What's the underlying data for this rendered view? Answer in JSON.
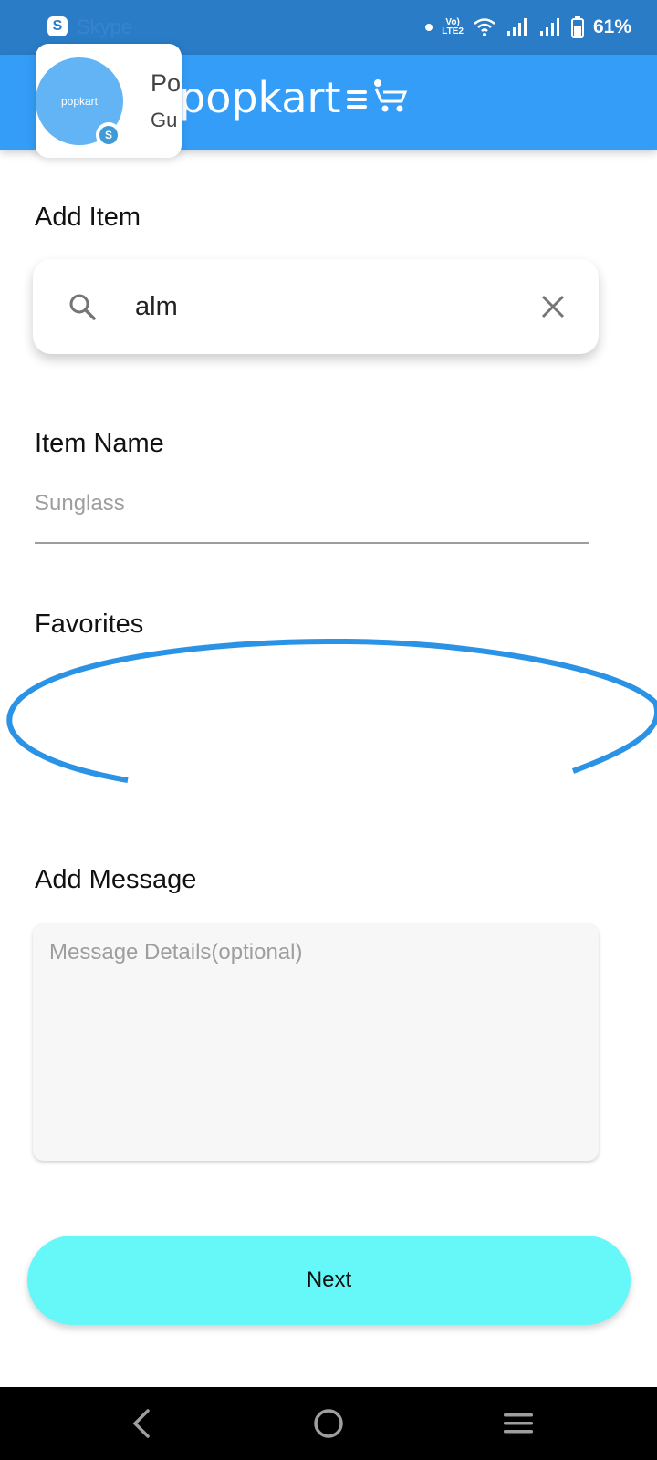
{
  "status_bar": {
    "notification_app": "Skype",
    "notification_icon_letter": "S",
    "network": [
      "Vo)",
      "LTE2"
    ],
    "battery": "61%"
  },
  "app_bar": {
    "brand": "popkart"
  },
  "bubble": {
    "avatar_text": "popkart",
    "badge": "S",
    "title": "Po",
    "subtitle": "Gu"
  },
  "add_item": {
    "label": "Add Item",
    "search_value": "alm"
  },
  "item_name": {
    "label": "Item Name",
    "placeholder": "Sunglass"
  },
  "favorites": {
    "label": "Favorites"
  },
  "message": {
    "label": "Add Message",
    "placeholder": "Message Details(optional)"
  },
  "next_label": "Next",
  "colors": {
    "status_bar": "#2a7cc7",
    "app_bar": "#349df7",
    "next_button": "#66f8f9",
    "spinner": "#2b93e6"
  }
}
